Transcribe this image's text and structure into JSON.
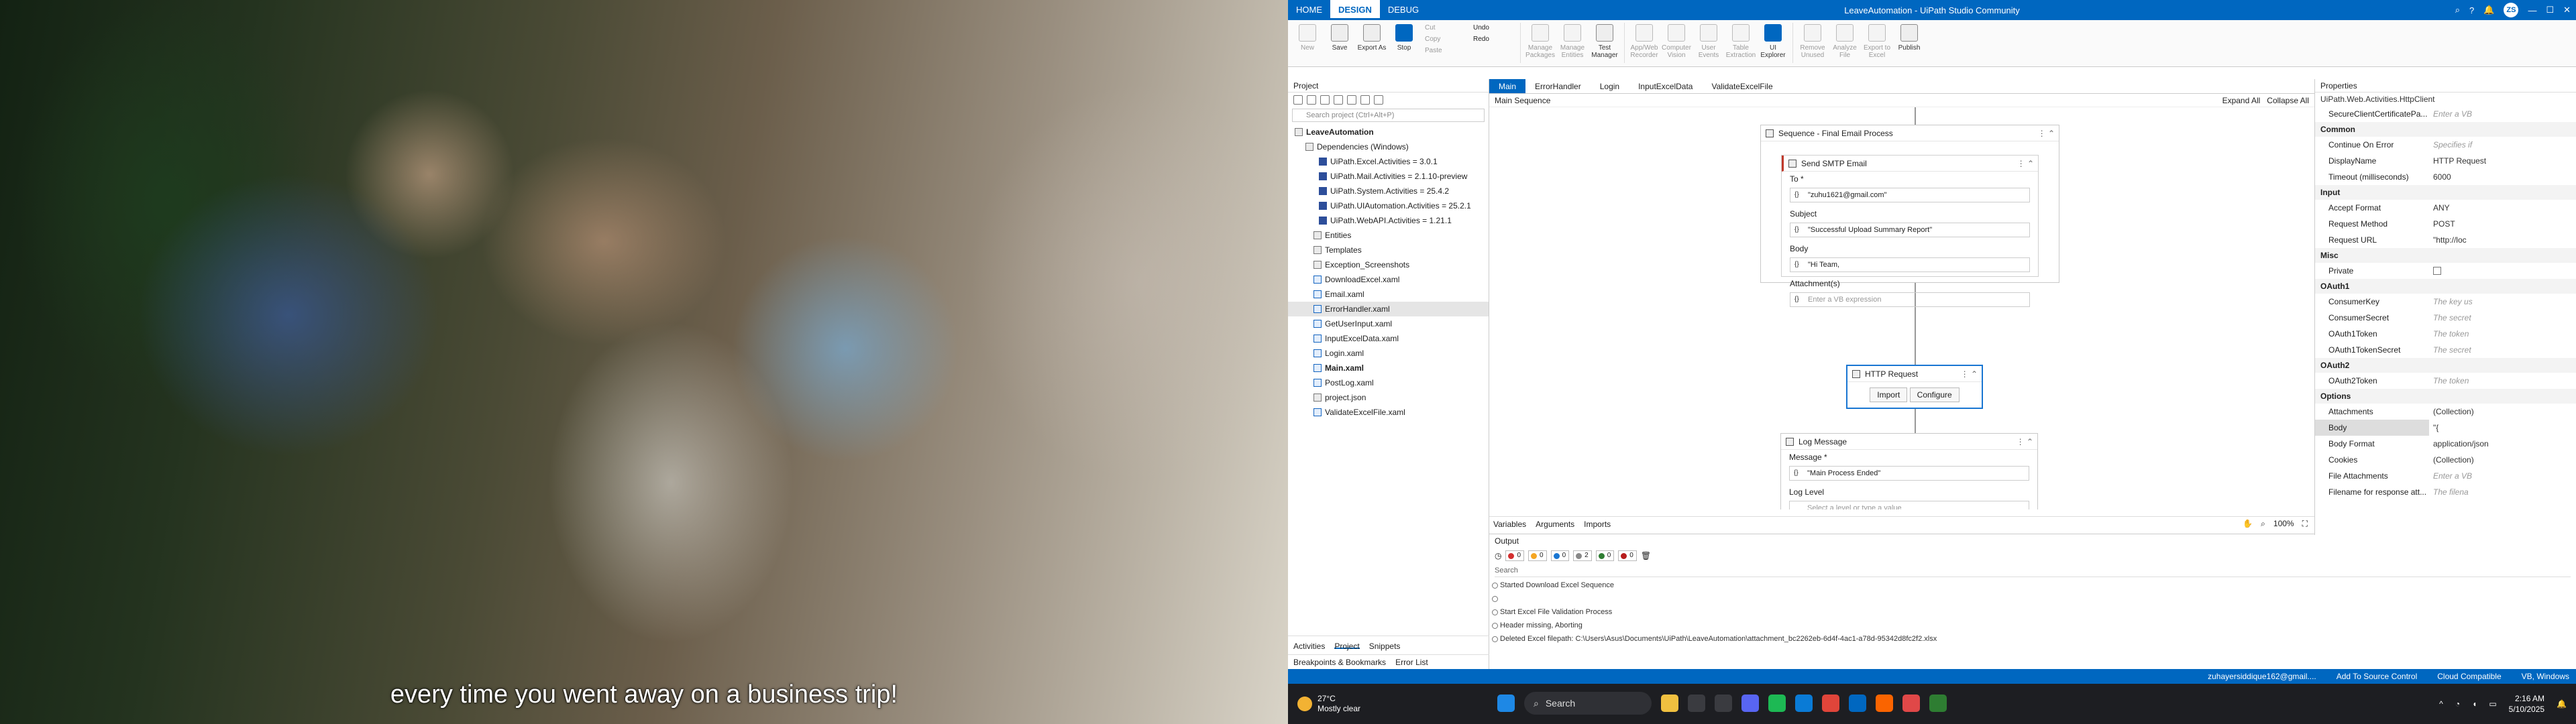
{
  "video": {
    "subtitle": "every time you went away on a business trip!"
  },
  "studio": {
    "menu_tabs": [
      "HOME",
      "DESIGN",
      "DEBUG"
    ],
    "window_title": "LeaveAutomation - UiPath Studio Community",
    "user_initials": "ZS",
    "ribbon": {
      "new": "New",
      "save": "Save",
      "export": "Export As",
      "stop": "Stop",
      "cut": "Cut",
      "copy": "Copy",
      "paste": "Paste",
      "undo": "Undo",
      "redo": "Redo",
      "manage_packages": "Manage Packages",
      "manage_entities": "Manage Entities",
      "test_manager": "Test Manager",
      "app_web_recorder": "App/Web Recorder",
      "computer_vision": "Computer Vision",
      "user_events": "User Events",
      "table_extraction": "Table Extraction",
      "ui_explorer": "UI Explorer",
      "remove_unused": "Remove Unused",
      "analyze_file": "Analyze File",
      "export_to_excel": "Export to Excel",
      "publish": "Publish"
    },
    "project": {
      "header": "Project",
      "search_placeholder": "Search project (Ctrl+Alt+P)",
      "root": "LeaveAutomation",
      "dependencies": "Dependencies (Windows)",
      "packages": [
        "UiPath.Excel.Activities = 3.0.1",
        "UiPath.Mail.Activities = 2.1.10-preview",
        "UiPath.System.Activities = 25.4.2",
        "UiPath.UIAutomation.Activities = 25.2.1",
        "UiPath.WebAPI.Activities = 1.21.1"
      ],
      "folders": [
        "Entities",
        "Templates",
        "Exception_Screenshots"
      ],
      "files": [
        "DownloadExcel.xaml",
        "Email.xaml",
        "ErrorHandler.xaml",
        "GetUserInput.xaml",
        "InputExcelData.xaml",
        "Login.xaml",
        "Main.xaml",
        "PostLog.xaml",
        "project.json",
        "ValidateExcelFile.xaml"
      ],
      "bottom_tabs": [
        "Activities",
        "Project",
        "Snippets"
      ],
      "lower_tabs": [
        "Breakpoints & Bookmarks",
        "Error List"
      ]
    },
    "doc_tabs": [
      "Main",
      "ErrorHandler",
      "Login",
      "InputExcelData",
      "ValidateExcelFile"
    ],
    "breadcrumb": "Main Sequence",
    "expand_all": "Expand All",
    "collapse_all": "Collapse All",
    "canvas": {
      "sequence_title": "Sequence - Final Email Process",
      "smtp": {
        "title": "Send SMTP Email",
        "to_label": "To *",
        "to_value": "\"zuhu1621@gmail.com\"",
        "subject_label": "Subject",
        "subject_value": "\"Successful Upload Summary Report\"",
        "body_label": "Body",
        "body_value": "\"Hi Team,",
        "attach_label": "Attachment(s)",
        "attach_placeholder": "Enter a VB expression"
      },
      "http": {
        "title": "HTTP Request",
        "import": "Import",
        "configure": "Configure"
      },
      "log": {
        "title": "Log Message",
        "message_label": "Message *",
        "message_value": "\"Main Process Ended\"",
        "level_label": "Log Level",
        "level_placeholder": "Select a level or type a value"
      }
    },
    "designer_tabs": [
      "Variables",
      "Arguments",
      "Imports"
    ],
    "zoom": "100%",
    "output": {
      "header": "Output",
      "chips": [
        "0",
        "0",
        "0",
        "2",
        "0",
        "0"
      ],
      "search": "Search",
      "lines": [
        "Started Download Excel Sequence",
        "Start Excel File Validation Process",
        "Header missing, Aborting",
        "Deleted Excel filepath: C:\\Users\\Asus\\Documents\\UiPath\\LeaveAutomation\\attachment_bc2262eb-6d4f-4ac1-a78d-95342d8fc2f2.xlsx"
      ]
    },
    "properties": {
      "header": "Properties",
      "type": "UiPath.Web.Activities.HttpClient",
      "groups": [
        {
          "name": null,
          "rows": [
            [
              "SecureClientCertificatePa...",
              "Enter a VB"
            ]
          ]
        },
        {
          "name": "Common",
          "rows": [
            [
              "Continue On Error",
              "Specifies if"
            ],
            [
              "DisplayName",
              "HTTP Request"
            ],
            [
              "Timeout (milliseconds)",
              "6000"
            ]
          ]
        },
        {
          "name": "Input",
          "rows": [
            [
              "Accept Format",
              "ANY"
            ],
            [
              "Request Method",
              "POST"
            ],
            [
              "Request URL",
              "\"http://loc"
            ]
          ]
        },
        {
          "name": "Misc",
          "rows": [
            [
              "Private",
              ""
            ]
          ]
        },
        {
          "name": "OAuth1",
          "rows": [
            [
              "ConsumerKey",
              "The key us"
            ],
            [
              "ConsumerSecret",
              "The secret"
            ],
            [
              "OAuth1Token",
              "The token"
            ],
            [
              "OAuth1TokenSecret",
              "The secret"
            ]
          ]
        },
        {
          "name": "OAuth2",
          "rows": [
            [
              "OAuth2Token",
              "The token"
            ]
          ]
        },
        {
          "name": "Options",
          "rows": [
            [
              "Attachments",
              "(Collection)"
            ],
            [
              "Body",
              "\"{"
            ],
            [
              "Body Format",
              "application/json"
            ],
            [
              "Cookies",
              "(Collection)"
            ],
            [
              "File Attachments",
              "Enter a VB"
            ],
            [
              "Filename for response att...",
              "The filena"
            ]
          ]
        }
      ]
    },
    "status": {
      "user": "zuhayersiddique162@gmail....",
      "source": "Add To Source Control",
      "compat": "Cloud Compatible",
      "vb": "VB, Windows"
    }
  },
  "taskbar": {
    "temp": "27°C",
    "weather": "Mostly clear",
    "search": "Search",
    "time": "2:16 AM",
    "date": "5/10/2025"
  },
  "colors": {
    "accent": "#0067c0",
    "taskbar": "#1d1e22"
  }
}
